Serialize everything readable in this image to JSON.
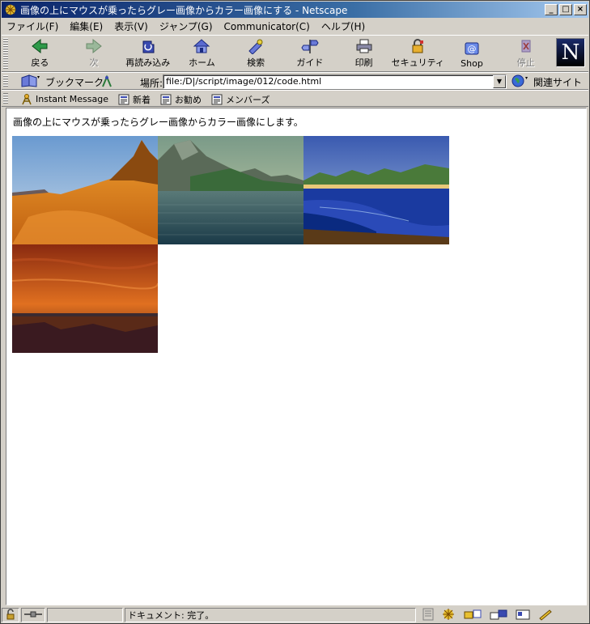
{
  "window": {
    "title": "画像の上にマウスが乗ったらグレー画像からカラー画像にする - Netscape",
    "minimize": "_",
    "maximize": "□",
    "close": "×"
  },
  "menu": [
    "ファイル(F)",
    "編集(E)",
    "表示(V)",
    "ジャンプ(G)",
    "Communicator(C)",
    "ヘルプ(H)"
  ],
  "nav_toolbar": {
    "buttons": [
      {
        "label": "戻る",
        "icon": "back-arrow-icon"
      },
      {
        "label": "次",
        "icon": "forward-arrow-icon"
      },
      {
        "label": "再読み込み",
        "icon": "reload-icon"
      },
      {
        "label": "ホーム",
        "icon": "home-icon"
      },
      {
        "label": "検索",
        "icon": "search-icon"
      },
      {
        "label": "ガイド",
        "icon": "guide-icon"
      },
      {
        "label": "印刷",
        "icon": "print-icon"
      },
      {
        "label": "セキュリティ",
        "icon": "lock-icon"
      },
      {
        "label": "Shop",
        "icon": "shop-icon"
      },
      {
        "label": "停止",
        "icon": "stop-icon"
      }
    ],
    "logo": "N"
  },
  "location_toolbar": {
    "bookmarks_label": "ブックマーク",
    "location_label": "場所:",
    "url": "file:/D|/script/image/012/code.html",
    "related_label": "関連サイト"
  },
  "personal_toolbar": {
    "items": [
      "Instant Message",
      "新着",
      "お勧め",
      "メンバーズ"
    ]
  },
  "content": {
    "intro_text": "画像の上にマウスが乗ったらグレー画像からカラー画像にします。"
  },
  "status": {
    "text": "ドキュメント: 完了。"
  },
  "colors": {
    "titlebar_start": "#0a246a",
    "titlebar_end": "#a6caf0",
    "chrome": "#d4d0c8"
  }
}
